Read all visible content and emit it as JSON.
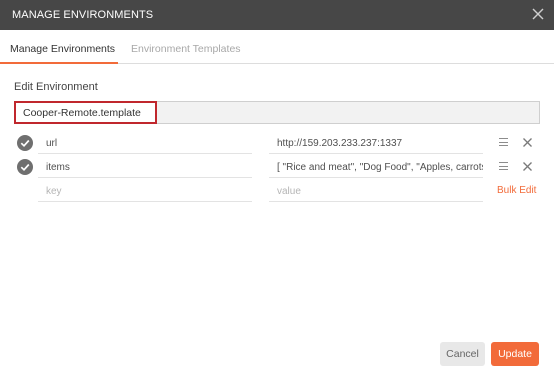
{
  "dialog": {
    "title": "MANAGE ENVIRONMENTS",
    "close_icon": "close-icon"
  },
  "tabs": [
    {
      "label": "Manage Environments",
      "active": true
    },
    {
      "label": "Environment Templates",
      "active": false
    }
  ],
  "editor": {
    "heading": "Edit Environment",
    "name_value": "Cooper-Remote.template"
  },
  "variables": [
    {
      "enabled": true,
      "key": "url",
      "value": "http://159.203.233.237:1337"
    },
    {
      "enabled": true,
      "key": "items",
      "value": "[  \"Rice and meat\",  \"Dog Food\",  \"Apples, carrots\""
    }
  ],
  "new_row": {
    "key_placeholder": "key",
    "value_placeholder": "value",
    "bulk_edit_label": "Bulk Edit"
  },
  "footer": {
    "cancel_label": "Cancel",
    "update_label": "Update"
  },
  "colors": {
    "accent": "#f26b3a",
    "titlebar": "#474747",
    "highlight_border": "#c0272d",
    "check": "#6f6f6f"
  }
}
